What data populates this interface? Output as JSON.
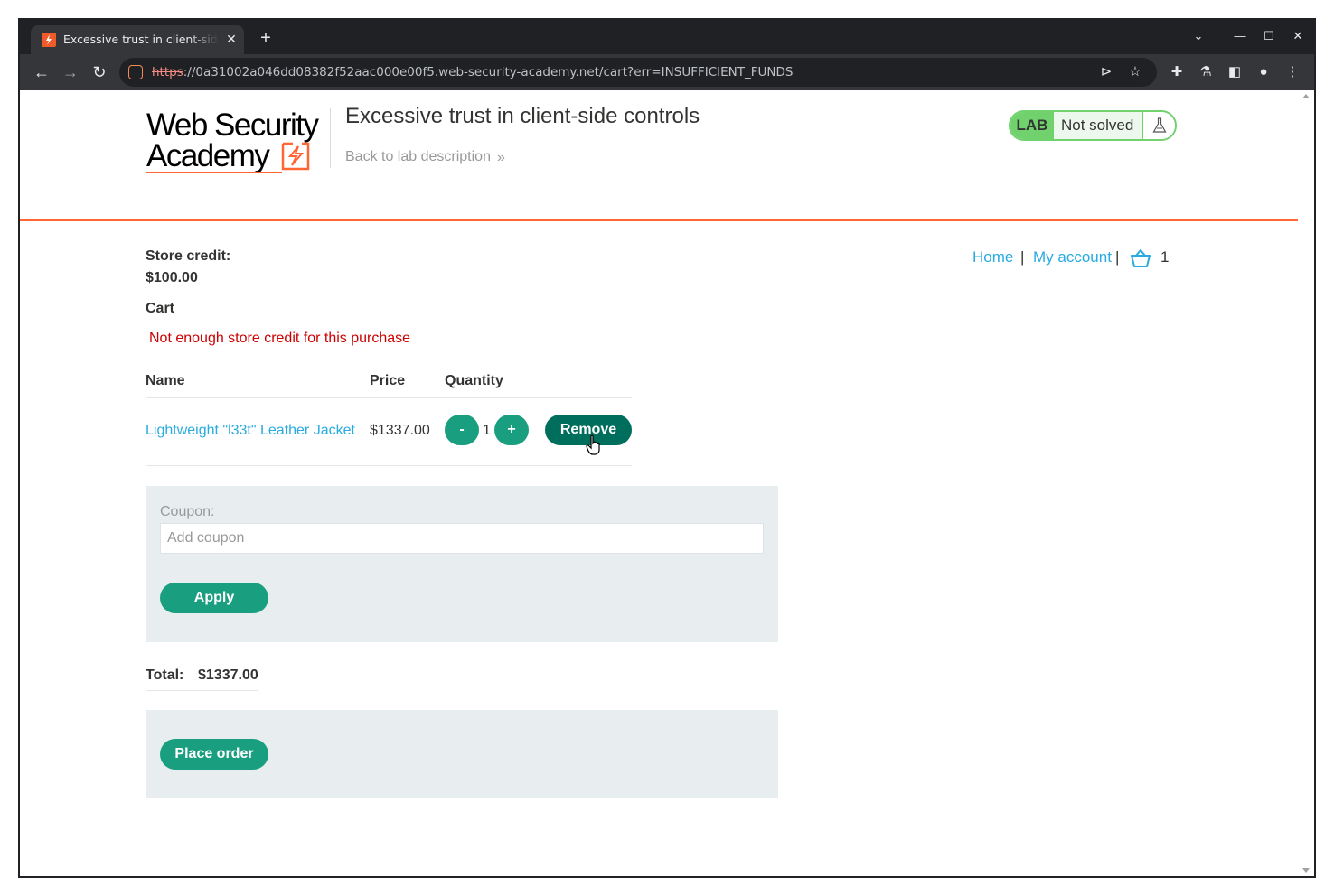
{
  "browser": {
    "tab_title": "Excessive trust in client-side controls",
    "url_scheme": "https",
    "url_rest": "://0a31002a046dd08382f52aac000e00f5.web-security-academy.net/cart?err=INSUFFICIENT_FUNDS",
    "new_tab": "+",
    "close_tab": "✕",
    "win_chevron": "⌄",
    "win_minimize": "—",
    "win_maximize": "☐",
    "win_close": "✕",
    "back": "←",
    "forward": "→",
    "reload": "↻",
    "send_icon": "⊳",
    "star_icon": "☆",
    "extensions_icon": "✚",
    "labs_icon": "⚗",
    "sidepanel_icon": "◧",
    "profile_icon": "●",
    "menu_icon": "⋮"
  },
  "header": {
    "logo_line1": "Web Security",
    "logo_line2": "Academy",
    "lab_title": "Excessive trust in client-side controls",
    "back_link": "Back to lab description",
    "back_chevron": "»",
    "badge_lab": "LAB",
    "badge_status": "Not solved",
    "badge_color": "#70d16d"
  },
  "nav": {
    "home": "Home",
    "separator": "|",
    "my_account": "My account",
    "cart_count": "1"
  },
  "account": {
    "credit_label": "Store credit:",
    "credit_value": "$100.00"
  },
  "cart": {
    "heading": "Cart",
    "error": "Not enough store credit for this purchase",
    "columns": [
      "Name",
      "Price",
      "Quantity"
    ],
    "items": [
      {
        "name": "Lightweight \"l33t\" Leather Jacket",
        "price": "$1337.00",
        "quantity": "1",
        "minus": "-",
        "plus": "+",
        "remove": "Remove"
      }
    ]
  },
  "coupon": {
    "label": "Coupon:",
    "placeholder": "Add coupon",
    "apply": "Apply"
  },
  "total": {
    "label": "Total:",
    "value": "$1337.00"
  },
  "order": {
    "place_order": "Place order"
  },
  "colors": {
    "accent_orange": "#ff6633",
    "button_green": "#1a9e80",
    "remove_green": "#006e5c",
    "link_blue": "#29abe0",
    "error_red": "#cc0000"
  }
}
